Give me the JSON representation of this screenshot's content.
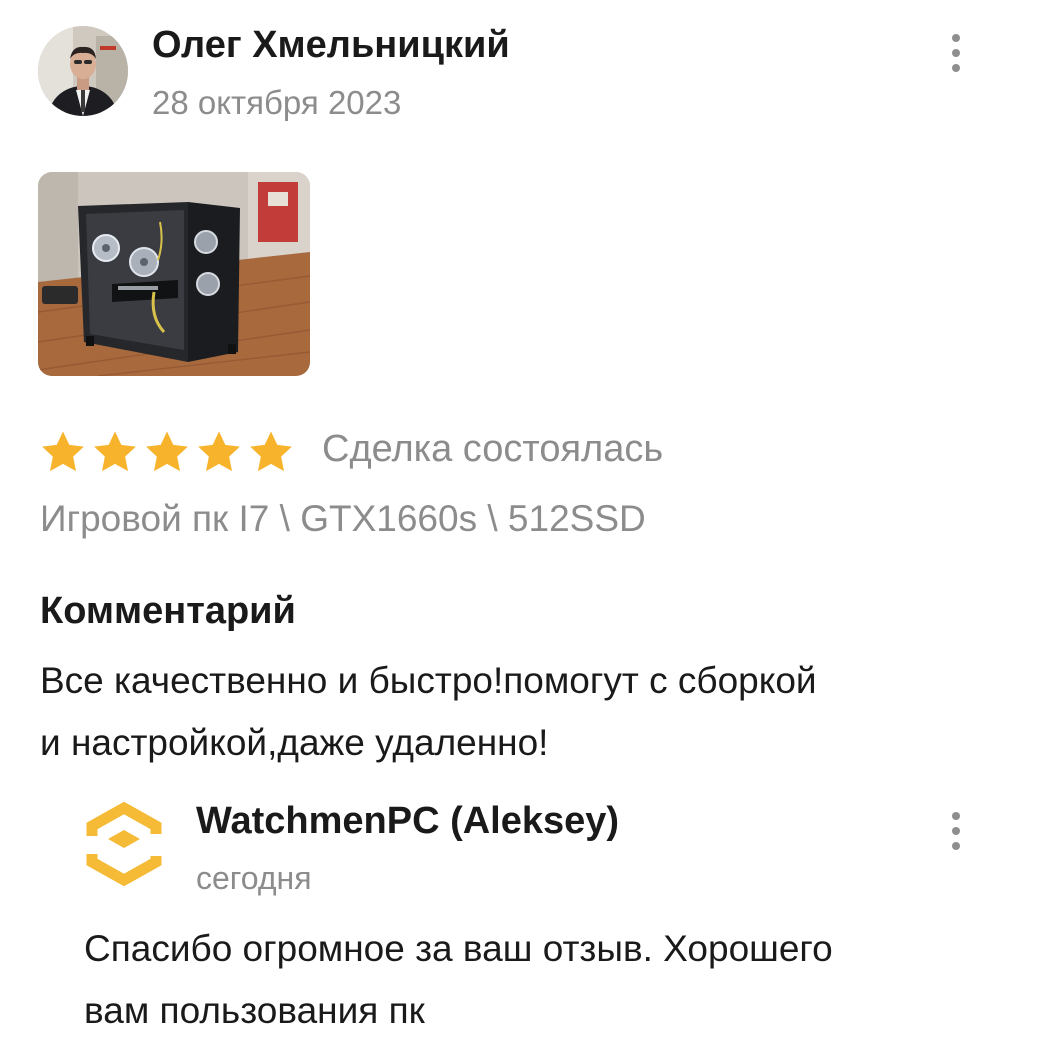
{
  "review": {
    "author_name": "Олег Хмельницкий",
    "date": "28 октября 2023",
    "rating": 5,
    "max_rating": 5,
    "deal_status": "Сделка состоялась",
    "product_name": "Игровой пк I7 \\ GTX1660s \\ 512SSD",
    "comment_title": "Комментарий",
    "comment_lines": [
      "Все качественно и быстро!помогут с сборкой",
      "и настройкой,даже удаленно!"
    ]
  },
  "reply": {
    "seller_name": "WatchmenPC (Aleksey)",
    "date": "сегодня",
    "text_lines": [
      "Спасибо огромное за ваш отзыв. Хорошего",
      "вам пользования пк"
    ]
  },
  "icons": {
    "star": "star-icon",
    "more": "more-vertical-icon",
    "seller_logo": "cube-logo-icon"
  },
  "colors": {
    "star": "#f7b32b",
    "seller_logo": "#f6bb36",
    "muted_text": "#8c8c8c",
    "text": "#1a1a1a"
  }
}
